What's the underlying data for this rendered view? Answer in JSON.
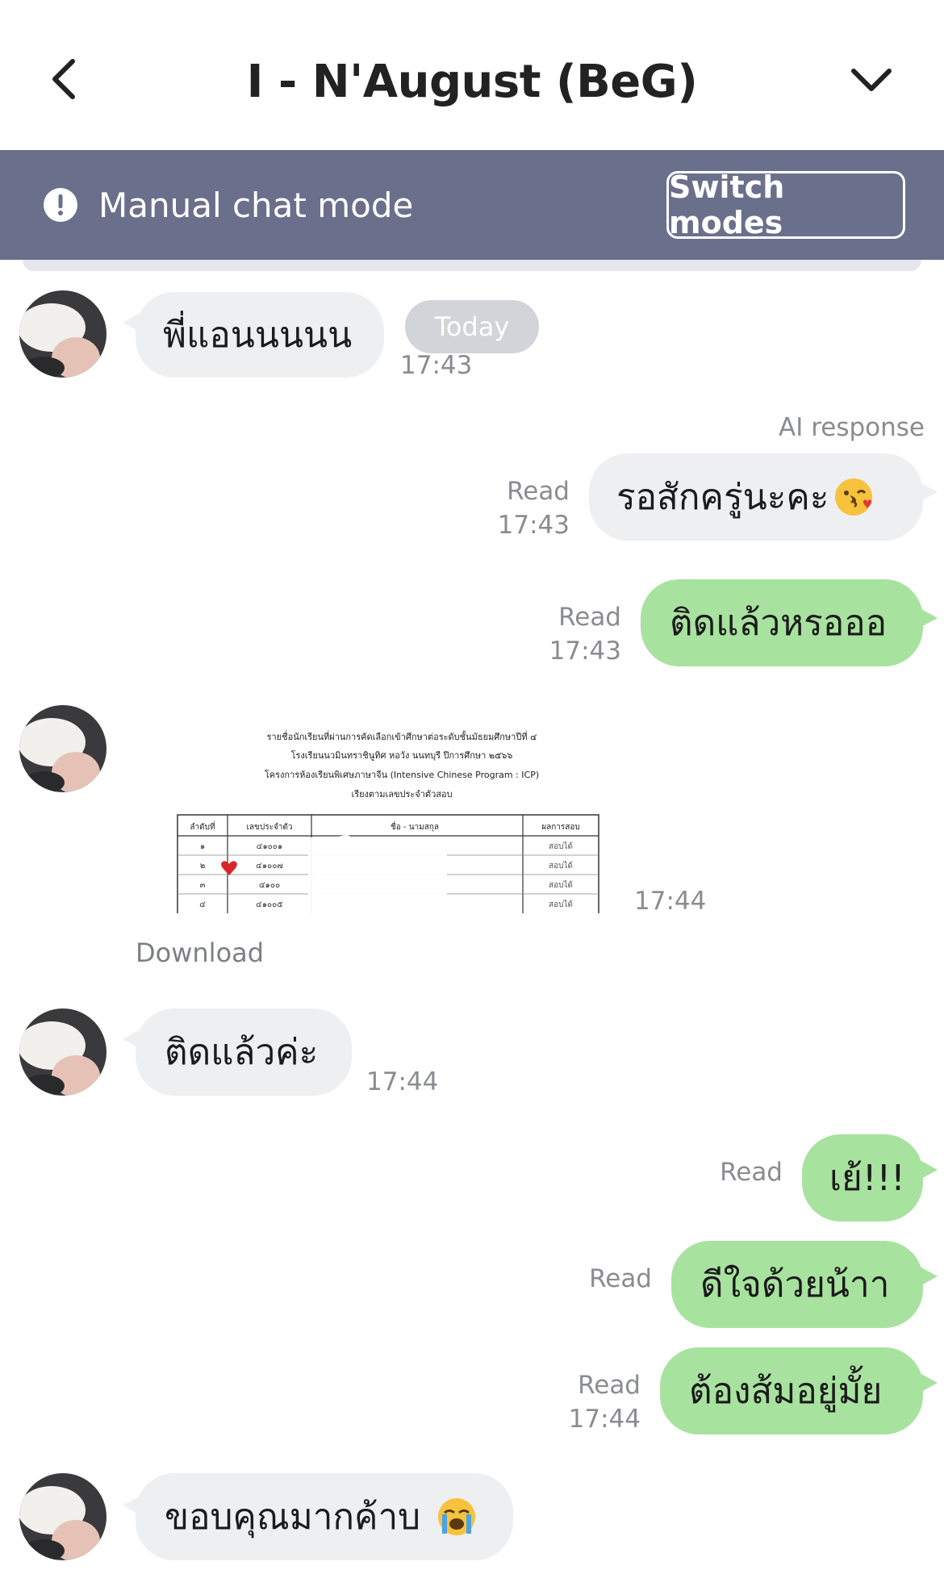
{
  "header": {
    "title": "I - N'August (BeG)"
  },
  "banner": {
    "label": "Manual chat mode",
    "switch_label": "Switch modes"
  },
  "date_divider": "Today",
  "ai_label": "AI response",
  "messages": [
    {
      "id": "m1",
      "direction": "in",
      "text": "พี่แอนนนนน",
      "time": "17:43"
    },
    {
      "id": "m2",
      "direction": "out",
      "style": "gray",
      "text": "รอสักครู่นะคะ",
      "status": "Read",
      "time": "17:43",
      "emoji": "kissing-face"
    },
    {
      "id": "m3",
      "direction": "out",
      "style": "green",
      "text": "ติดแล้วหรอออ",
      "status": "Read",
      "time": "17:43"
    },
    {
      "id": "m4",
      "direction": "in",
      "type": "image",
      "time": "17:44",
      "download_label": "Download",
      "image": {
        "lines": [
          "รายชื่อนักเรียนที่ผ่านการคัดเลือกเข้าศึกษาต่อระดับชั้นมัธยมศึกษาปีที่ ๔",
          "โรงเรียนนวมินทราชินูทิศ หอวัง นนทบุรี ปีการศึกษา ๒๕๖๖",
          "โครงการห้องเรียนพิเศษภาษาจีน (Intensive Chinese Program : ICP)",
          "เรียงตามเลขประจำตัวสอบ"
        ],
        "table_headers": [
          "ลำดับที่",
          "เลขประจำตัว",
          "ชื่อ - นามสกุล",
          "ผลการสอบ"
        ],
        "rows": [
          [
            "๑",
            "๔๑๐๐๑",
            "สอบได้"
          ],
          [
            "๒",
            "๔๑๐๐๗",
            "สอบได้"
          ],
          [
            "๓",
            "๔๑๐๐",
            "สอบได้"
          ],
          [
            "๔",
            "๔๑๐๐๕",
            "สอบได้"
          ]
        ]
      }
    },
    {
      "id": "m5",
      "direction": "in",
      "text": "ติดแล้วค่ะ",
      "time": "17:44"
    },
    {
      "id": "m6",
      "direction": "out",
      "style": "green",
      "text": "เย้!!!",
      "status": "Read"
    },
    {
      "id": "m7",
      "direction": "out",
      "style": "green",
      "text": "ดีใจด้วยน้าา",
      "status": "Read"
    },
    {
      "id": "m8",
      "direction": "out",
      "style": "green",
      "text": "ต้องส้มอยู่มั้ย",
      "status": "Read",
      "time": "17:44"
    },
    {
      "id": "m9",
      "direction": "in",
      "text": "ขอบคุณมากค้าบ",
      "emoji": "loudly-crying-face"
    }
  ],
  "colors": {
    "banner": "#6a6f8b",
    "incoming_bubble": "#eeeff1",
    "outgoing_green": "#a8e29f",
    "meta_text": "#8a8c91"
  }
}
